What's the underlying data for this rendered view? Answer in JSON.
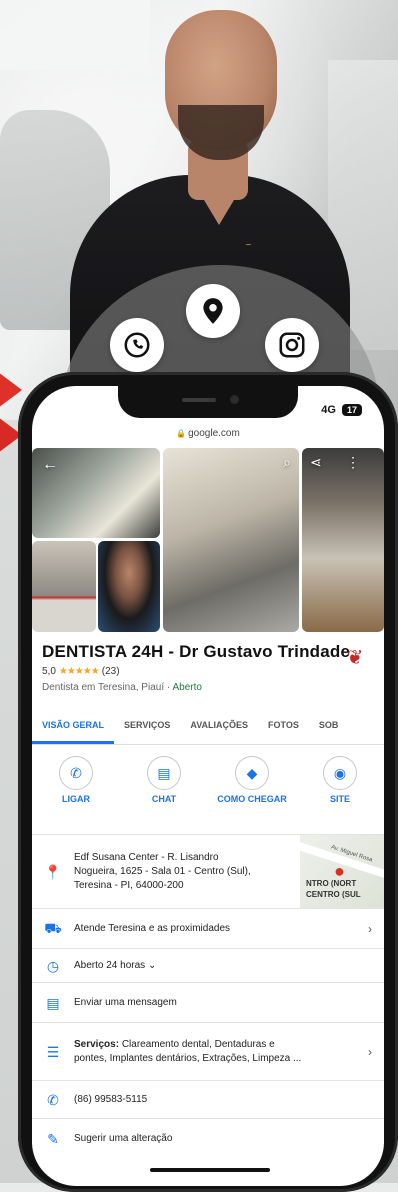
{
  "hero": {
    "social_icons": [
      "whatsapp-icon",
      "location-pin-icon",
      "instagram-icon"
    ],
    "accent_color": "#e0302a"
  },
  "phone": {
    "status": {
      "network": "4G",
      "battery": "17"
    },
    "url": "google.com",
    "business": {
      "title": "DENTISTA 24H - Dr Gustavo Trindade",
      "rating": "5,0",
      "stars": "★★★★★",
      "reviews": "(23)",
      "category": "Dentista em Teresina, Piauí",
      "separator": "·",
      "status": "Aberto"
    },
    "tabs": [
      "VISÃO GERAL",
      "SERVIÇOS",
      "AVALIAÇÕES",
      "FOTOS",
      "SOB"
    ],
    "actions": [
      {
        "label": "LIGAR",
        "icon": "phone-icon"
      },
      {
        "label": "CHAT",
        "icon": "chat-icon"
      },
      {
        "label": "COMO CHEGAR",
        "icon": "directions-icon"
      },
      {
        "label": "SITE",
        "icon": "globe-icon"
      }
    ],
    "address": {
      "line1": "Edf Susana Center - R. Lisandro",
      "line2": "Nogueira, 1625 - Sala 01 - Centro (Sul),",
      "line3": "Teresina - PI, 64000-200"
    },
    "map": {
      "street": "Av. Miguel Rosa",
      "label1": "NTRO (NORT",
      "label2": "CENTRO (SUL"
    },
    "service_area": "Atende Teresina e as proximidades",
    "hours": "Aberto 24 horas",
    "message": "Enviar uma mensagem",
    "services": {
      "label": "Serviços:",
      "line1": "Clareamento dental, Dentaduras e",
      "line2": "pontes, Implantes dentários, Extrações, Limpeza ..."
    },
    "phone_number": "(86) 99583-5115",
    "suggest": "Sugerir uma alteração"
  }
}
